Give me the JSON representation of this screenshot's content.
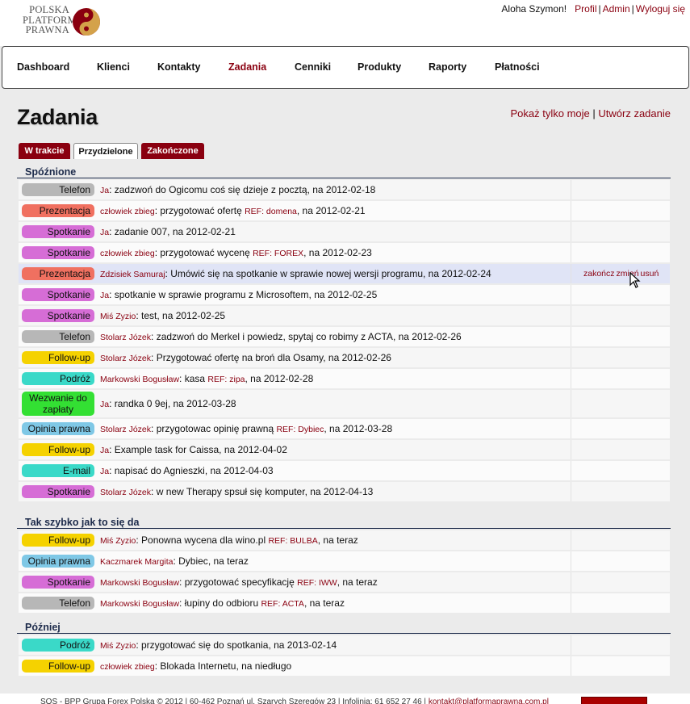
{
  "logo": {
    "line1": "POLSKA",
    "line2": "PLATFORMA",
    "line3": "PRAWNA"
  },
  "user": {
    "greeting": "Aloha Szymon!",
    "profile": "Profil",
    "admin": "Admin",
    "logout": "Wyloguj się"
  },
  "nav": [
    "Dashboard",
    "Klienci",
    "Kontakty",
    "Zadania",
    "Cenniki",
    "Produkty",
    "Raporty",
    "Płatności"
  ],
  "page": {
    "title": "Zadania",
    "only_mine": "Pokaż tylko moje",
    "create": "Utwórz zadanie"
  },
  "tabs": [
    "W trakcie",
    "Przydzielone",
    "Zakończone"
  ],
  "row_actions": {
    "finish": "zakończ",
    "change": "zmień",
    "delete": "usuń"
  },
  "colors": {
    "Telefon": "#b7b7b7",
    "Prezentacja": "#f07060",
    "Spotkanie": "#d66dd6",
    "Follow-up": "#f5d200",
    "Podróż": "#3ad9c8",
    "Wezwanie do zapłaty": "#33e033",
    "Opinia prawna": "#7fc8e6",
    "E-mail": "#3ad9c8"
  },
  "sections": [
    {
      "title": "Spóźnione",
      "tasks": [
        {
          "type": "Telefon",
          "who": "Ja",
          "text": "zadzwoń do Ogicomu coś się dzieje z pocztą",
          "ref": "",
          "when": "na 2012-02-18"
        },
        {
          "type": "Prezentacja",
          "who": "człowiek zbieg",
          "text": "przygotować ofertę",
          "ref": "REF: domena",
          "when": "na 2012-02-21"
        },
        {
          "type": "Spotkanie",
          "who": "Ja",
          "text": "zadanie 007",
          "ref": "",
          "when": "na 2012-02-21"
        },
        {
          "type": "Spotkanie",
          "who": "człowiek zbieg",
          "text": "przygotować wycenę",
          "ref": "REF: FOREX",
          "when": "na 2012-02-23"
        },
        {
          "type": "Prezentacja",
          "who": "Zdzisiek Samuraj",
          "text": "Umówić się na spotkanie w sprawie nowej wersji programu",
          "ref": "",
          "when": "na 2012-02-24",
          "hover": true
        },
        {
          "type": "Spotkanie",
          "who": "Ja",
          "text": "spotkanie w sprawie programu z Microsoftem",
          "ref": "",
          "when": "na 2012-02-25"
        },
        {
          "type": "Spotkanie",
          "who": "Miś Zyzio",
          "text": "test",
          "ref": "",
          "when": "na 2012-02-25"
        },
        {
          "type": "Telefon",
          "who": "Stolarz Józek",
          "text": "zadzwoń do Merkel i powiedz, spytaj co robimy z ACTA",
          "ref": "",
          "when": "na 2012-02-26"
        },
        {
          "type": "Follow-up",
          "who": "Stolarz Józek",
          "text": "Przygotować ofertę na broń dla Osamy",
          "ref": "",
          "when": "na 2012-02-26"
        },
        {
          "type": "Podróż",
          "who": "Markowski Bogusław",
          "text": "kasa",
          "ref": "REF: zipa",
          "when": "na 2012-02-28"
        },
        {
          "type": "Wezwanie do zapłaty",
          "type_line1": "Wezwanie do",
          "type_line2": "zapłaty",
          "who": "Ja",
          "text": "randka 0 9ej",
          "ref": "",
          "when": "na 2012-03-28",
          "tall": true
        },
        {
          "type": "Opinia prawna",
          "who": "Stolarz Józek",
          "text": "przygotowac opinię prawną",
          "ref": "REF: Dybiec",
          "when": "na 2012-03-28"
        },
        {
          "type": "Follow-up",
          "who": "Ja",
          "text": "Example task for Caissa",
          "ref": "",
          "when": "na 2012-04-02"
        },
        {
          "type": "E-mail",
          "who": "Ja",
          "text": "napisać do Agnieszki",
          "ref": "",
          "when": "na 2012-04-03"
        },
        {
          "type": "Spotkanie",
          "who": "Stolarz Józek",
          "text": "w new Therapy spsuł się komputer",
          "ref": "",
          "when": "na 2012-04-13"
        }
      ]
    },
    {
      "title": "Tak szybko jak to się da",
      "tasks": [
        {
          "type": "Follow-up",
          "who": "Miś Zyzio",
          "text": "Ponowna wycena dla wino.pl",
          "ref": "REF: BULBA",
          "when": "na teraz"
        },
        {
          "type": "Opinia prawna",
          "who": "Kaczmarek Margita",
          "text": "Dybiec",
          "ref": "",
          "when": "na teraz"
        },
        {
          "type": "Spotkanie",
          "who": "Markowski Bogusław",
          "text": "przygotować specyfikację",
          "ref": "REF: IWW",
          "when": "na teraz"
        },
        {
          "type": "Telefon",
          "who": "Markowski Bogusław",
          "text": "łupiny do odbioru",
          "ref": "REF: ACTA",
          "when": "na teraz"
        }
      ]
    },
    {
      "title": "Później",
      "tasks": [
        {
          "type": "Podróż",
          "who": "Miś Zyzio",
          "text": "przygotować się do spotkania",
          "ref": "",
          "when": "na 2013-02-14"
        },
        {
          "type": "Follow-up",
          "who": "człowiek zbieg",
          "text": "Blokada Internetu",
          "ref": "",
          "when": "na niedługo"
        }
      ]
    }
  ],
  "footer": {
    "text": "SOS - BPP Grupa Forex Polska © 2012 | 60-462 Poznań ul. Szarych Szeregów 23 | Infolinia: 61 652 27 46 |",
    "email": "kontakt@platformaprawna.com.pl"
  }
}
